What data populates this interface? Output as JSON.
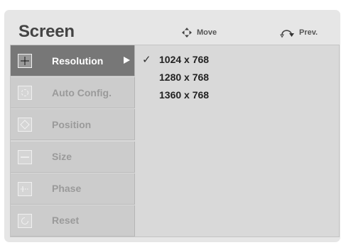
{
  "header": {
    "title": "Screen",
    "move_hint": "Move",
    "prev_hint": "Prev."
  },
  "menu": {
    "items": [
      {
        "label": "Resolution",
        "icon": "crosshair-icon",
        "active": true
      },
      {
        "label": "Auto Config.",
        "icon": "auto-config-icon",
        "active": false
      },
      {
        "label": "Position",
        "icon": "position-icon",
        "active": false
      },
      {
        "label": "Size",
        "icon": "size-icon",
        "active": false
      },
      {
        "label": "Phase",
        "icon": "phase-icon",
        "active": false
      },
      {
        "label": "Reset",
        "icon": "reset-icon",
        "active": false
      }
    ]
  },
  "submenu": {
    "check_mark": "✓",
    "options": [
      {
        "label": "1024 x 768",
        "selected": true
      },
      {
        "label": "1280 x 768",
        "selected": false
      },
      {
        "label": "1360 x 768",
        "selected": false
      }
    ]
  },
  "colors": {
    "background": "#e6e6e6",
    "panel": "#d9d9d9",
    "active_item": "#777777",
    "inactive_item": "#cccccc",
    "inactive_text": "#9a9a9a"
  }
}
